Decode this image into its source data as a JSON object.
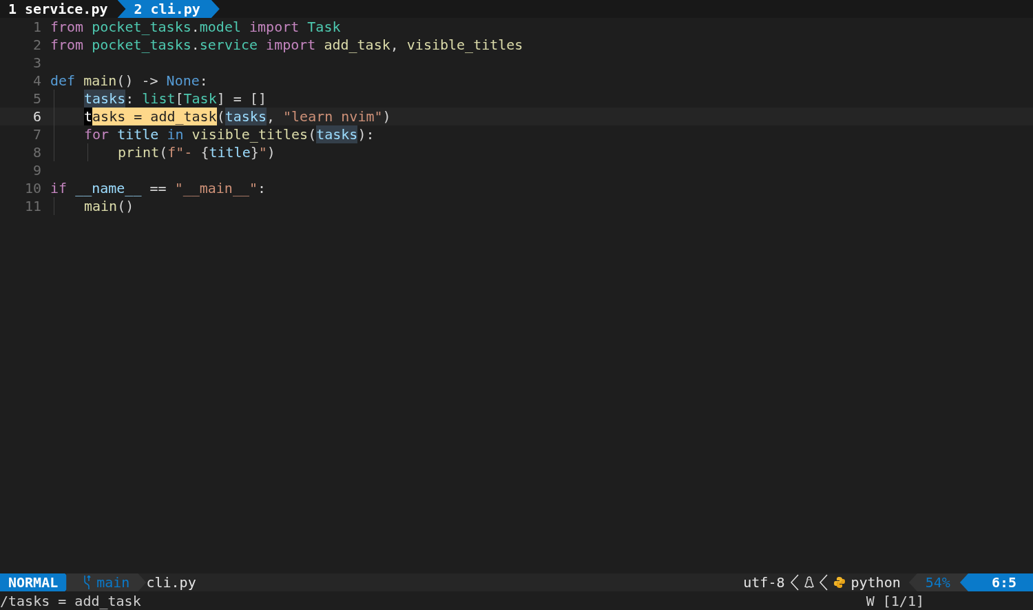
{
  "tabs": [
    {
      "label": "1 service.py",
      "selected": false
    },
    {
      "label": "2 cli.py",
      "selected": true
    }
  ],
  "lines": [
    {
      "number": "1",
      "current": false,
      "tokens": [
        {
          "text": "from ",
          "kind": "keyword"
        },
        {
          "text": "pocket_tasks",
          "kind": "module"
        },
        {
          "text": ".",
          "kind": "plain"
        },
        {
          "text": "model ",
          "kind": "module"
        },
        {
          "text": "import ",
          "kind": "keyword"
        },
        {
          "text": "Task",
          "kind": "module"
        }
      ]
    },
    {
      "number": "2",
      "current": false,
      "tokens": [
        {
          "text": "from ",
          "kind": "keyword"
        },
        {
          "text": "pocket_tasks",
          "kind": "module"
        },
        {
          "text": ".",
          "kind": "plain"
        },
        {
          "text": "service ",
          "kind": "module"
        },
        {
          "text": "import ",
          "kind": "keyword"
        },
        {
          "text": "add_task",
          "kind": "function"
        },
        {
          "text": ", ",
          "kind": "plain"
        },
        {
          "text": "visible_titles",
          "kind": "function"
        }
      ]
    },
    {
      "number": "3",
      "current": false
    },
    {
      "number": "4",
      "current": false,
      "tokens": [
        {
          "text": "def ",
          "kind": "storage"
        },
        {
          "text": "main",
          "kind": "function"
        },
        {
          "text": "() -> ",
          "kind": "plain"
        },
        {
          "text": "None",
          "kind": "storage"
        },
        {
          "text": ":",
          "kind": "plain"
        }
      ],
      "children": [
        {
          "number": "5",
          "current": false,
          "tokens": [
            {
              "text": "tasks",
              "kind": "reference"
            },
            {
              "text": ": ",
              "kind": "plain"
            },
            {
              "text": "list",
              "kind": "module"
            },
            {
              "text": "[",
              "kind": "plain"
            },
            {
              "text": "Task",
              "kind": "module"
            },
            {
              "text": "] = []",
              "kind": "plain"
            }
          ]
        },
        {
          "number": "6",
          "current": true,
          "tokens": [
            {
              "text": "t",
              "kind": "cursor"
            },
            {
              "text": "asks = add_task",
              "kind": "search_match"
            },
            {
              "text": "(",
              "kind": "plain"
            },
            {
              "text": "tasks",
              "kind": "reference"
            },
            {
              "text": ", ",
              "kind": "plain"
            },
            {
              "text": "\"learn nvim\"",
              "kind": "string"
            },
            {
              "text": ")",
              "kind": "plain"
            }
          ]
        },
        {
          "number": "7",
          "current": false,
          "tokens": [
            {
              "text": "for ",
              "kind": "keyword"
            },
            {
              "text": "title ",
              "kind": "variable"
            },
            {
              "text": "in ",
              "kind": "storage"
            },
            {
              "text": "visible_titles",
              "kind": "function"
            },
            {
              "text": "(",
              "kind": "plain"
            },
            {
              "text": "tasks",
              "kind": "reference"
            },
            {
              "text": "):",
              "kind": "plain"
            }
          ],
          "children": [
            {
              "number": "8",
              "current": false,
              "tokens": [
                {
                  "text": "print",
                  "kind": "function"
                },
                {
                  "text": "(",
                  "kind": "plain"
                },
                {
                  "text": "f\"- ",
                  "kind": "string"
                },
                {
                  "text": "{",
                  "kind": "plain"
                },
                {
                  "text": "title",
                  "kind": "variable"
                },
                {
                  "text": "}",
                  "kind": "plain"
                },
                {
                  "text": "\"",
                  "kind": "string"
                },
                {
                  "text": ")",
                  "kind": "plain"
                }
              ]
            }
          ]
        }
      ]
    },
    {
      "number": "9",
      "current": false
    },
    {
      "number": "10",
      "current": false,
      "tokens": [
        {
          "text": "if ",
          "kind": "keyword"
        },
        {
          "text": "__name__",
          "kind": "variable"
        },
        {
          "text": " == ",
          "kind": "plain"
        },
        {
          "text": "\"__main__\"",
          "kind": "string"
        },
        {
          "text": ":",
          "kind": "plain"
        }
      ],
      "children": [
        {
          "number": "11",
          "current": false,
          "tokens": [
            {
              "text": "main",
              "kind": "function"
            },
            {
              "text": "()",
              "kind": "plain"
            }
          ]
        }
      ]
    }
  ],
  "status_bar": {
    "mode": "NORMAL",
    "branch": "main",
    "file": "cli.py",
    "encoding": "utf-8",
    "filetype": "python",
    "progress": "54%",
    "position": "6:5"
  },
  "command_line": {
    "text": "/tasks = add_task",
    "search_count": "W [1/1]"
  }
}
